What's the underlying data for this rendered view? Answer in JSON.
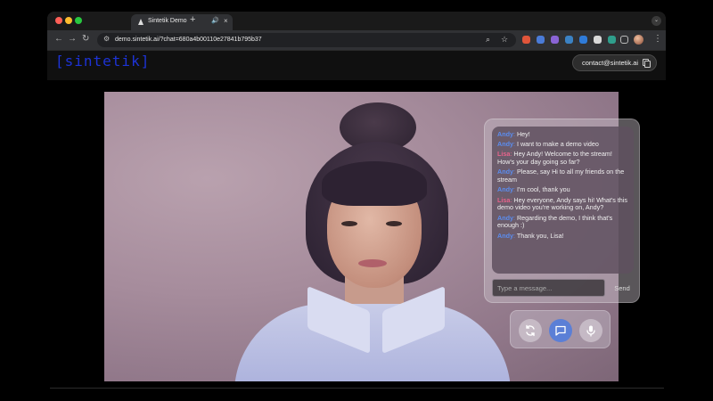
{
  "browser": {
    "tab_title": "Sintetik Demo",
    "url": "demo.sintetik.ai/?chat=680a4b00110e27841b795b37",
    "new_tab_label": "+",
    "close_tab_label": "×"
  },
  "site": {
    "logo_text": "[sintetik]",
    "contact_label": "contact@sintetik.ai"
  },
  "chat": {
    "messages": [
      {
        "sender": "Andy",
        "text": "Hey!"
      },
      {
        "sender": "Andy",
        "text": "I want to make a demo video"
      },
      {
        "sender": "Lisa",
        "text": "Hey Andy! Welcome to the stream! How's your day going so far?"
      },
      {
        "sender": "Andy",
        "text": "Please, say Hi to all my friends on the stream"
      },
      {
        "sender": "Andy",
        "text": "I'm cool, thank you"
      },
      {
        "sender": "Lisa",
        "text": "Hey everyone, Andy says hi! What's this demo video you're working on, Andy?"
      },
      {
        "sender": "Andy",
        "text": "Regarding the demo, I think that's enough :)"
      },
      {
        "sender": "Andy",
        "text": "Thank you, Lisa!"
      }
    ],
    "input_placeholder": "Type a message...",
    "send_label": "Send"
  },
  "colors": {
    "andy": "#5b8def",
    "lisa": "#e8648c",
    "logo": "#1d33d6",
    "accent_button": "#5b7fd6"
  },
  "icons": {
    "reset": "refresh-icon",
    "chat": "chat-icon",
    "mic": "microphone-icon"
  }
}
